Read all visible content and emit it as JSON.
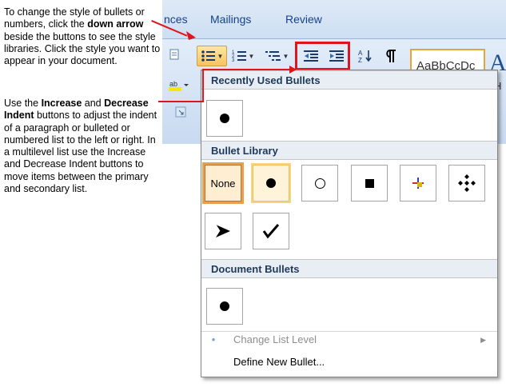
{
  "annotation": {
    "para1": {
      "before": "To change the style of bullets or numbers, click the ",
      "bold": "down arrow",
      "after": " beside the buttons to see the style libraries. Click the style you want to appear in your document."
    },
    "para2": {
      "pre": "Use the ",
      "bold1": "Increase",
      "mid": " and ",
      "bold2": "Decrease Indent",
      "after": " buttons to adjust the indent of a paragraph or bulleted or numbered list to the left or right.  In a multilevel list use the Increase and Decrease Indent buttons to move items between the primary and secondary list."
    }
  },
  "ribbon": {
    "tabs": [
      "nces",
      "Mailings",
      "Review"
    ],
    "style_preview": "AaBbCcDc",
    "style_big": "A",
    "style_small": "H"
  },
  "dropdown": {
    "recent_header": "Recently Used Bullets",
    "library_header": "Bullet Library",
    "none_label": "None",
    "document_header": "Document Bullets",
    "change_level": "Change List Level",
    "define_new": "Define New Bullet..."
  },
  "colors": {
    "callout_red": "#e0141d",
    "selection_orange": "#e9a04a",
    "ribbon_blue": "#c4d7ee"
  }
}
